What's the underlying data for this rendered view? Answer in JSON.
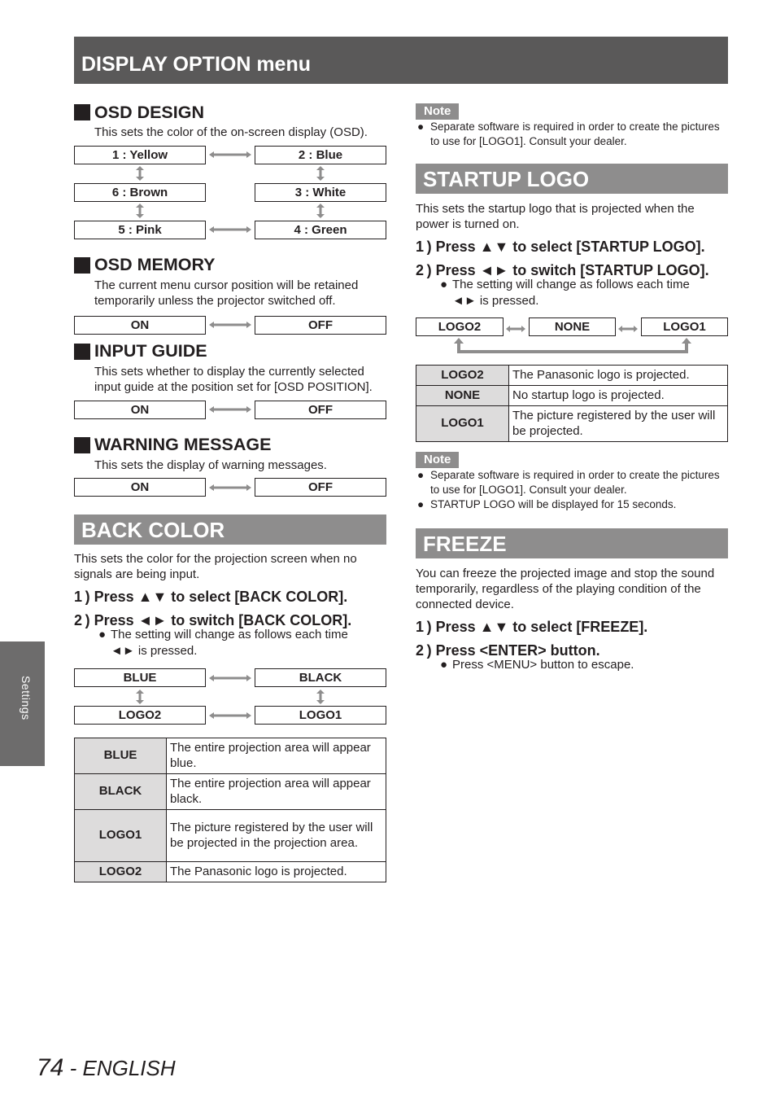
{
  "header": {
    "title": "DISPLAY OPTION menu"
  },
  "side_tab": {
    "label": "Settings"
  },
  "footer": {
    "page_number": "74",
    "language": " - ENGLISH"
  },
  "osd_design": {
    "title": "OSD DESIGN",
    "description": "This sets the color of the on-screen display (OSD).",
    "options": [
      "1 : Yellow",
      "2 : Blue",
      "6 : Brown",
      "3 : White",
      "5 : Pink",
      "4 : Green"
    ]
  },
  "osd_memory": {
    "title": "OSD MEMORY",
    "description": "The current menu cursor position will be retained temporarily unless the projector switched off.",
    "options": [
      "ON",
      "OFF"
    ]
  },
  "input_guide": {
    "title": "INPUT GUIDE",
    "description": "This sets whether to display the currently selected input guide at the position set for [OSD POSITION].",
    "options": [
      "ON",
      "OFF"
    ]
  },
  "warning_message": {
    "title": "WARNING MESSAGE",
    "description": "This sets the display of warning messages.",
    "options": [
      "ON",
      "OFF"
    ]
  },
  "back_color": {
    "title": "BACK COLOR",
    "description": "This sets the color for the projection screen when no signals are being input.",
    "steps": [
      "1 )  Press ▲▼ to select [BACK COLOR].",
      "2 )  Press ◄► to switch [BACK COLOR]."
    ],
    "bullet_line1": "The setting will change as follows each time",
    "bullet_line2": "◄► is pressed.",
    "options": [
      "BLUE",
      "BLACK",
      "LOGO2",
      "LOGO1"
    ],
    "table": [
      {
        "key": "BLUE",
        "value": "The entire projection area will appear blue."
      },
      {
        "key": "BLACK",
        "value": "The entire projection area will appear black."
      },
      {
        "key": "LOGO1",
        "value": "The picture registered by the user will be projected in the projection area."
      },
      {
        "key": "LOGO2",
        "value": "The Panasonic logo is projected."
      }
    ]
  },
  "note1": {
    "label": "Note",
    "items": [
      "Separate software is required in order to create the pictures to use for [LOGO1]. Consult your dealer."
    ]
  },
  "startup_logo": {
    "title": "STARTUP LOGO",
    "description": "This sets the startup logo that is projected when the power is turned on.",
    "steps": [
      "1 )  Press ▲▼ to select [STARTUP LOGO].",
      "2 )  Press ◄► to switch [STARTUP LOGO]."
    ],
    "bullet_line1": "The setting will change as follows each time",
    "bullet_line2": "◄► is pressed.",
    "options": [
      "LOGO2",
      "NONE",
      "LOGO1"
    ],
    "table": [
      {
        "key": "LOGO2",
        "value": "The Panasonic logo is projected."
      },
      {
        "key": "NONE",
        "value": "No startup logo is projected."
      },
      {
        "key": "LOGO1",
        "value": "The picture registered by the user will be projected."
      }
    ]
  },
  "note2": {
    "label": "Note",
    "items": [
      "Separate software is required in order to create the pictures to use for [LOGO1]. Consult your dealer.",
      "STARTUP LOGO will be displayed for 15 seconds."
    ]
  },
  "freeze": {
    "title": "FREEZE",
    "description": "You can freeze the projected image and stop the sound temporarily, regardless of the playing condition of the connected device.",
    "steps": [
      "1 )  Press ▲▼ to select [FREEZE].",
      "2 )  Press <ENTER> button."
    ],
    "bullet": "Press <MENU> button to escape."
  },
  "colors": {
    "header_bg": "#5a5959",
    "section_bar": "#8e8d8d",
    "table_key_bg": "#dddcdc",
    "arrow": "#8e8d8d"
  }
}
